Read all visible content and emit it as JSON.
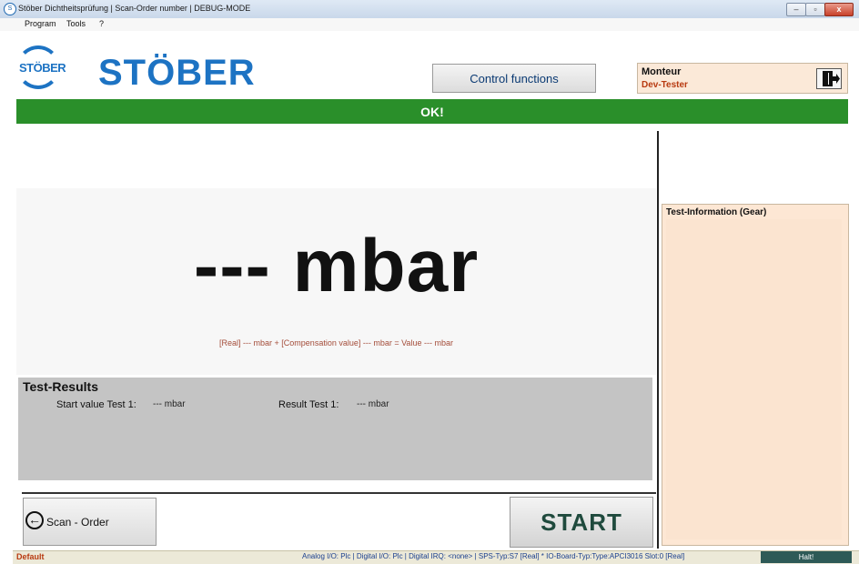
{
  "window": {
    "title": "Stöber Dichtheitsprüfung | Scan-Order number | DEBUG-MODE",
    "app_icon": "stober-app-icon",
    "controls": {
      "minimize": "–",
      "maximize": "▫",
      "close": "x"
    }
  },
  "menu": {
    "items": [
      "Program",
      "Tools",
      "?"
    ]
  },
  "header": {
    "logo_small_text": "STÖBER",
    "brand_text": "STÖBER",
    "control_button": "Control functions",
    "user": {
      "role": "Monteur",
      "name": "Dev-Tester"
    },
    "logout_icon": "logout-door-icon"
  },
  "status": {
    "text": "OK!",
    "color": "#2a8f2a"
  },
  "measurement": {
    "value": "--- mbar",
    "formula": "[Real] --- mbar + [Compensation value] --- mbar = Value --- mbar"
  },
  "results": {
    "title": "Test-Results",
    "start_label": "Start value Test 1:",
    "start_value": "--- mbar",
    "result_label": "Result Test 1:",
    "result_value": "--- mbar"
  },
  "test_info": {
    "title": "Test-Information (Gear)"
  },
  "buttons": {
    "scan": "Scan - Order",
    "start": "START"
  },
  "footer": {
    "profile": "Default",
    "info": "Analog I/O: Plc  |  Digital I/O: Plc  |  Digital IRQ: <none>  |  SPS-Typ:S7 [Real] * IO-Board-Typ:Type:APCI3016 Slot:0 [Real]",
    "halt": "Halt!"
  },
  "colors": {
    "brand_blue": "#1d73c3",
    "status_green": "#2a8f2a",
    "panel_peach": "#fde7d4",
    "user_name_red": "#b83a10"
  }
}
